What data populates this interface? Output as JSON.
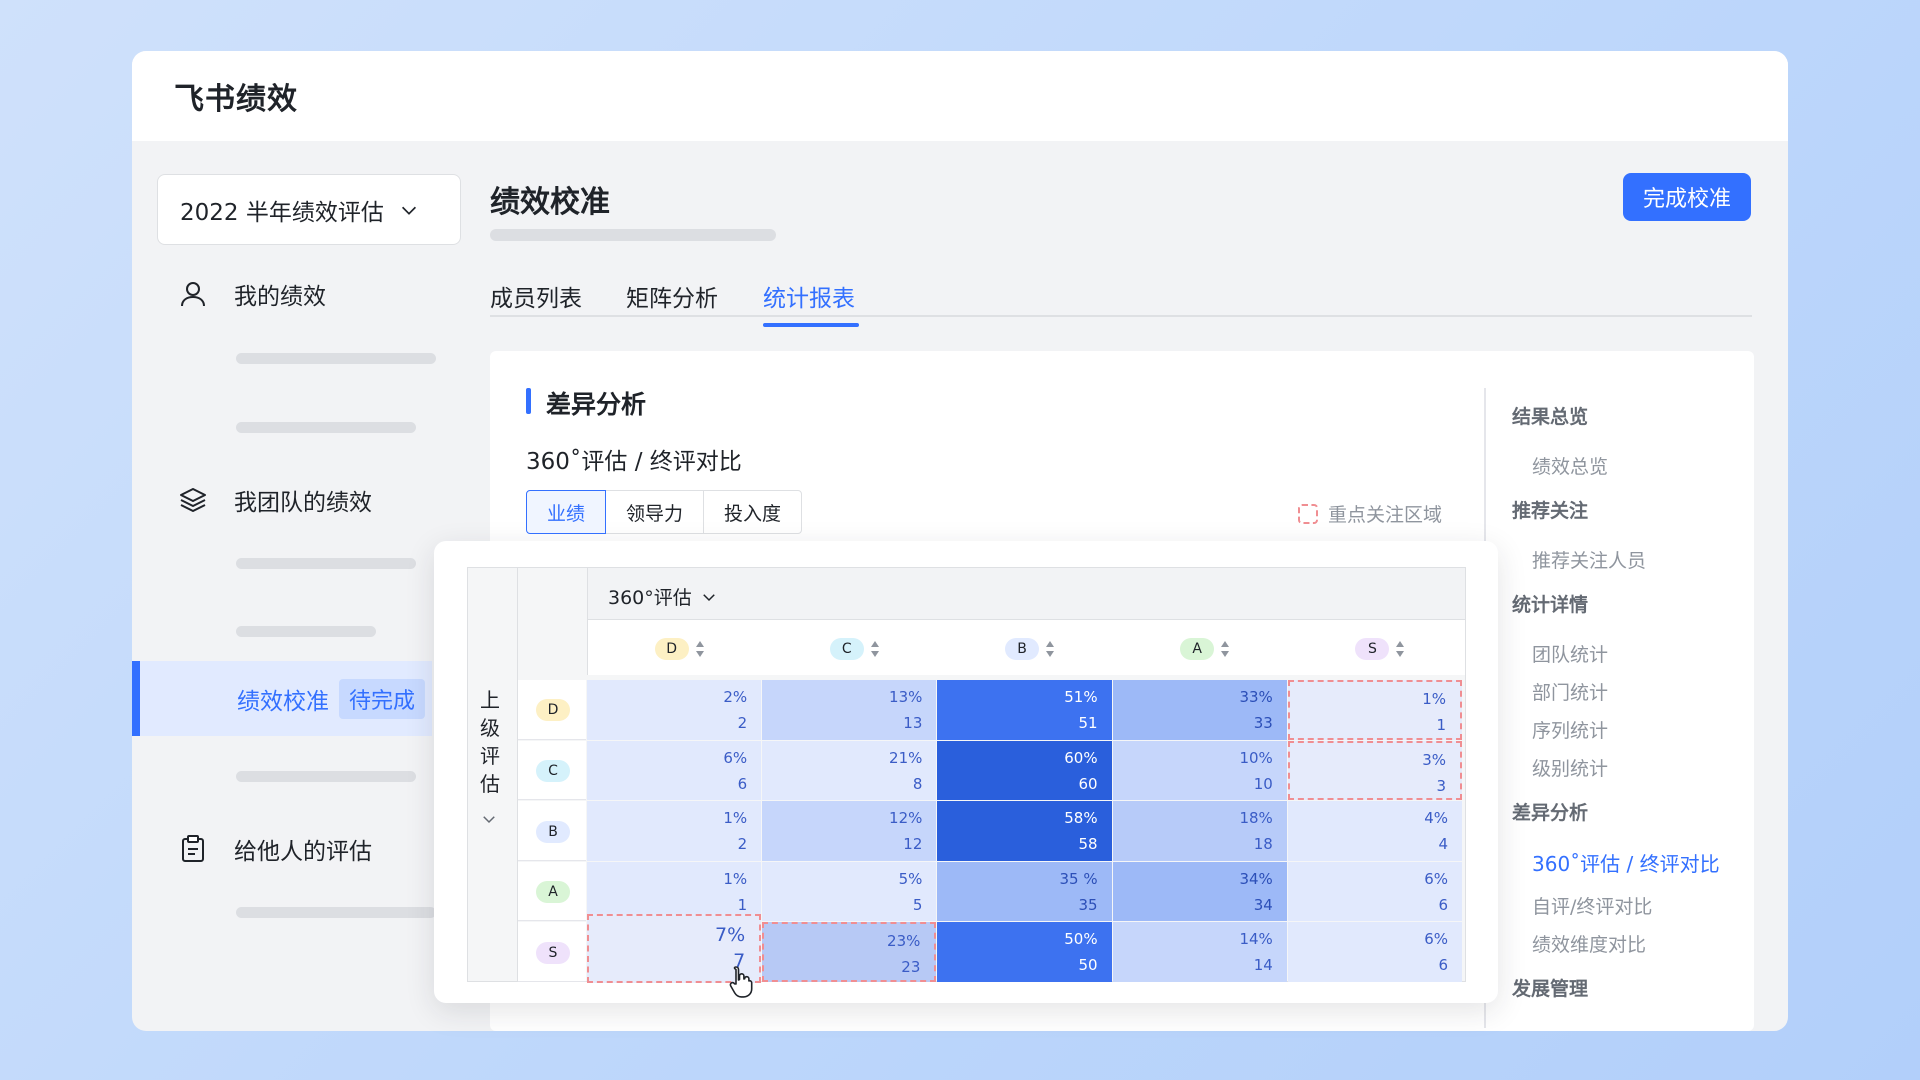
{
  "app": {
    "title": "飞书绩效"
  },
  "sidebar": {
    "cycle": "2022 半年绩效评估",
    "items": [
      {
        "label": "我的绩效"
      },
      {
        "label": "我团队的绩效"
      },
      {
        "label": "绩效校准",
        "tag": "待完成"
      },
      {
        "label": "给他人的评估"
      }
    ]
  },
  "main": {
    "title": "绩效校准",
    "done_button": "完成校准",
    "tabs": [
      {
        "label": "成员列表"
      },
      {
        "label": "矩阵分析"
      },
      {
        "label": "统计报表"
      }
    ],
    "section_title": "差异分析",
    "subtitle": "360˚评估 / 终评对比",
    "segments": [
      "业绩",
      "领导力",
      "投入度"
    ],
    "focus_legend": "重点关注区域"
  },
  "matrix": {
    "column_header": "360°评估",
    "row_header": [
      "上",
      "级",
      "评",
      "估"
    ],
    "grades": [
      "D",
      "C",
      "B",
      "A",
      "S"
    ],
    "cells": [
      [
        {
          "pct": "2%",
          "n": "2"
        },
        {
          "pct": "13%",
          "n": "13"
        },
        {
          "pct": "51%",
          "n": "51"
        },
        {
          "pct": "33%",
          "n": "33"
        },
        {
          "pct": "1%",
          "n": "1"
        }
      ],
      [
        {
          "pct": "6%",
          "n": "6"
        },
        {
          "pct": "21%",
          "n": "8"
        },
        {
          "pct": "60%",
          "n": "60"
        },
        {
          "pct": "10%",
          "n": "10"
        },
        {
          "pct": "3%",
          "n": "3"
        }
      ],
      [
        {
          "pct": "1%",
          "n": "2"
        },
        {
          "pct": "12%",
          "n": "12"
        },
        {
          "pct": "58%",
          "n": "58"
        },
        {
          "pct": "18%",
          "n": "18"
        },
        {
          "pct": "4%",
          "n": "4"
        }
      ],
      [
        {
          "pct": "1%",
          "n": "1"
        },
        {
          "pct": "5%",
          "n": "5"
        },
        {
          "pct": "35 %",
          "n": "35"
        },
        {
          "pct": "34%",
          "n": "34"
        },
        {
          "pct": "6%",
          "n": "6"
        }
      ],
      [
        {
          "pct": "7%",
          "n": "7"
        },
        {
          "pct": "23%",
          "n": "23"
        },
        {
          "pct": "50%",
          "n": "50"
        },
        {
          "pct": "14%",
          "n": "14"
        },
        {
          "pct": "6%",
          "n": "6"
        }
      ]
    ]
  },
  "anchor_nav": {
    "groups": [
      {
        "title": "结果总览",
        "items": [
          "绩效总览"
        ]
      },
      {
        "title": "推荐关注",
        "items": [
          "推荐关注人员"
        ]
      },
      {
        "title": "统计详情",
        "items": [
          "团队统计",
          "部门统计",
          "序列统计",
          "级别统计"
        ]
      },
      {
        "title": "差异分析",
        "items": [
          "360˚评估 / 终评对比",
          "自评/终评对比",
          "绩效维度对比"
        ]
      },
      {
        "title": "发展管理",
        "items": []
      }
    ]
  },
  "colors": {
    "accent": "#3370ff",
    "badge_D": "#fdf0c4",
    "badge_C": "#d5f2fb",
    "badge_B": "#e1eaff",
    "badge_A": "#d9f5d6",
    "badge_S": "#efe2fb"
  }
}
